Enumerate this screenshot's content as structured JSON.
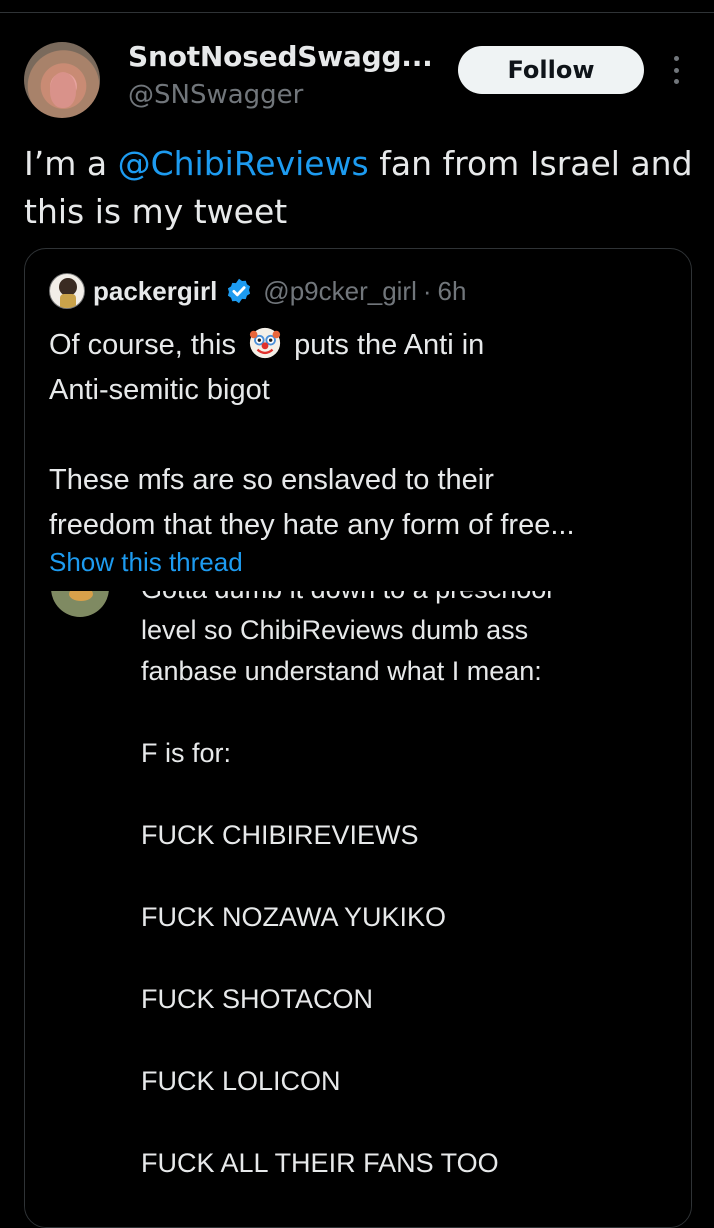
{
  "author": {
    "display_name": "SnotNosedSwagg...",
    "handle": "@SNSwagger",
    "follow_label": "Follow"
  },
  "tweet": {
    "text_before": "I’m a ",
    "mention": "@ChibiReviews",
    "text_after": " fan from Israel and this is my tweet"
  },
  "quote": {
    "name": "packergirl",
    "handle": "@p9cker_girl",
    "separator": "·",
    "time": "6h",
    "line1_before": "Of course, this ",
    "line1_after": " puts the Anti in",
    "line2": "Anti-semitic bigot",
    "line3": "These mfs are so enslaved to their",
    "line4": "freedom that they hate any form of free...",
    "show_thread": "Show this thread"
  },
  "embedded": {
    "lines": [
      "Gotta dumb it down to a preschool",
      "level so ChibiReviews dumb ass",
      "fanbase understand what I mean:",
      "",
      "F is for:",
      "",
      "FUCK CHIBIREVIEWS",
      "",
      "FUCK NOZAWA YUKIKO",
      "",
      "FUCK SHOTACON",
      "",
      "FUCK LOLICON",
      "",
      "FUCK ALL THEIR FANS TOO"
    ]
  },
  "colors": {
    "background": "#000000",
    "text": "#e7e9ea",
    "secondary": "#71767b",
    "accent": "#1d9bf0",
    "border": "#2f3336"
  }
}
